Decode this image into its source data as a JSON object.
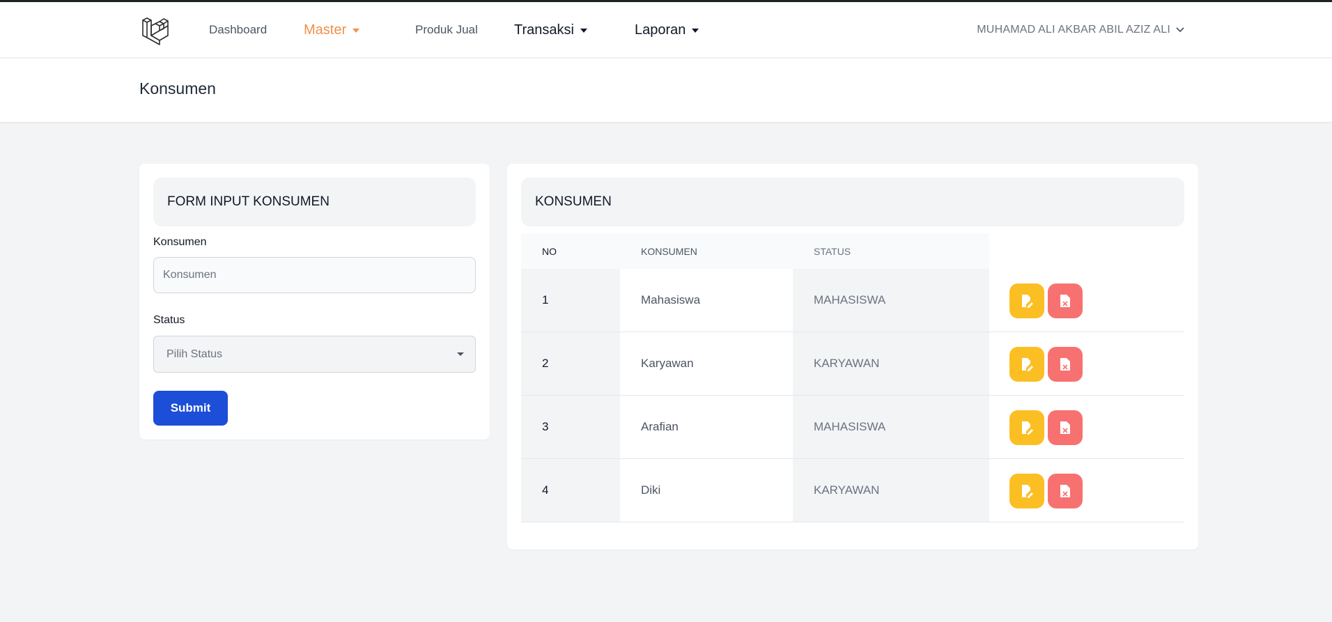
{
  "nav": {
    "logo": "laravel-logo",
    "links": {
      "dashboard": "Dashboard",
      "master": "Master",
      "produk_jual": "Produk Jual",
      "transaksi": "Transaksi",
      "laporan": "Laporan"
    },
    "active": "Master",
    "user": "MUHAMAD ALI AKBAR ABIL AZIZ ALI"
  },
  "page": {
    "title": "Konsumen"
  },
  "form": {
    "title": "FORM INPUT KONSUMEN",
    "konsumen_label": "Konsumen",
    "konsumen_placeholder": "Konsumen",
    "status_label": "Status",
    "status_placeholder": "Pilih Status",
    "submit": "Submit"
  },
  "table": {
    "title": "KONSUMEN",
    "headers": {
      "no": "NO",
      "konsumen": "KONSUMEN",
      "status": "STATUS"
    },
    "rows": [
      {
        "no": "1",
        "konsumen": "Mahasiswa",
        "status": "MAHASISWA"
      },
      {
        "no": "2",
        "konsumen": "Karyawan",
        "status": "KARYAWAN"
      },
      {
        "no": "3",
        "konsumen": "Arafian",
        "status": "MAHASISWA"
      },
      {
        "no": "4",
        "konsumen": "Diki",
        "status": "KARYAWAN"
      }
    ],
    "action_icons": {
      "edit": "file-edit-icon",
      "delete": "file-delete-icon"
    }
  },
  "colors": {
    "accent": "#f0914a",
    "primary": "#1d4ed8",
    "edit": "#fbbf24",
    "delete": "#f87171",
    "background": "#f3f4f6"
  }
}
